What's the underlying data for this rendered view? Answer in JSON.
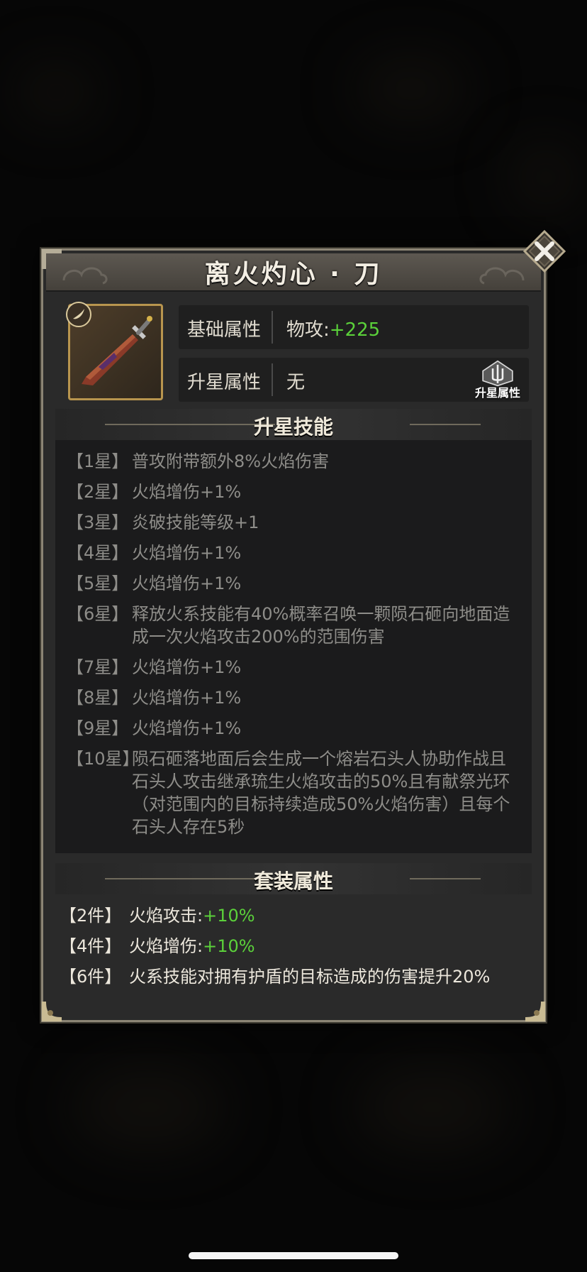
{
  "item": {
    "name": "离火灼心 · 刀"
  },
  "attributes": {
    "base_label": "基础属性",
    "base_value_name": "物攻:",
    "base_value_num": "+225",
    "star_label": "升星属性",
    "star_value": "无",
    "star_button_label": "升星属性"
  },
  "skills_section": {
    "title": "升星技能",
    "items": [
      {
        "tag": "【1星】",
        "text": "普攻附带额外8%火焰伤害"
      },
      {
        "tag": "【2星】",
        "text": "火焰增伤+1%"
      },
      {
        "tag": "【3星】",
        "text": "炎破技能等级+1"
      },
      {
        "tag": "【4星】",
        "text": "火焰增伤+1%"
      },
      {
        "tag": "【5星】",
        "text": "火焰增伤+1%"
      },
      {
        "tag": "【6星】",
        "text": "释放火系技能有40%概率召唤一颗陨石砸向地面造成一次火焰攻击200%的范围伤害"
      },
      {
        "tag": "【7星】",
        "text": "火焰增伤+1%"
      },
      {
        "tag": "【8星】",
        "text": "火焰增伤+1%"
      },
      {
        "tag": "【9星】",
        "text": "火焰增伤+1%"
      },
      {
        "tag": "【10星】",
        "text": "陨石砸落地面后会生成一个熔岩石头人协助作战且石头人攻击继承琉生火焰攻击的50%且有献祭光环（对范围内的目标持续造成50%火焰伤害）且每个石头人存在5秒"
      }
    ]
  },
  "set_section": {
    "title": "套装属性",
    "items": [
      {
        "tag": "【2件】",
        "name": "火焰攻击:",
        "value": "+10%"
      },
      {
        "tag": "【4件】",
        "name": "火焰增伤:",
        "value": "+10%"
      },
      {
        "tag": "【6件】",
        "name": "火系技能对拥有护盾的目标造成的伤害提升20%",
        "value": ""
      }
    ]
  },
  "colors": {
    "positive_value": "#5bd13a",
    "panel_border": "#8c8575",
    "item_frame": "#b8954e"
  },
  "icons": {
    "close": "crossed-swords-close-icon",
    "item": "sword-icon",
    "star_upgrade": "trident-emblem-icon"
  }
}
